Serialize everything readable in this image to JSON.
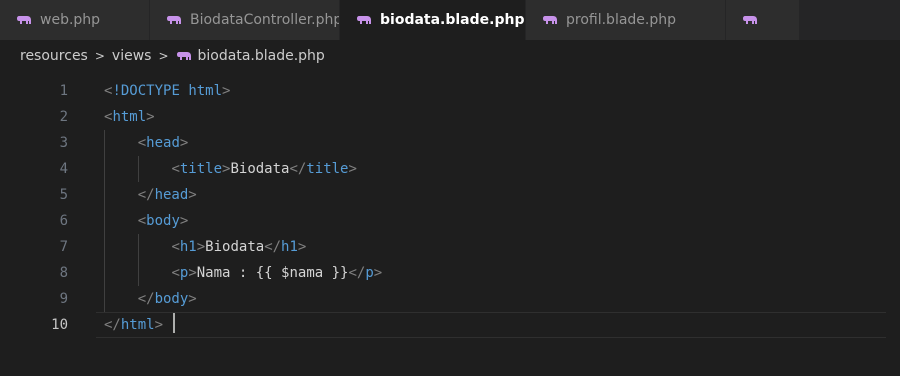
{
  "tabs": [
    {
      "label": "web.php",
      "active": false,
      "icon": "php-elephant-icon"
    },
    {
      "label": "BiodataController.php",
      "active": false,
      "icon": "php-elephant-icon"
    },
    {
      "label": "biodata.blade.php",
      "active": true,
      "icon": "php-elephant-icon",
      "close": "×"
    },
    {
      "label": "profil.blade.php",
      "active": false,
      "icon": "php-elephant-icon"
    }
  ],
  "breadcrumb": {
    "parts": [
      "resources",
      "views",
      "biodata.blade.php"
    ],
    "separator": ">"
  },
  "editor": {
    "current_line": 10,
    "lines": [
      {
        "number": "1",
        "tokens": [
          [
            "punct",
            "<"
          ],
          [
            "tag",
            "!DOCTYPE"
          ],
          [
            "txt",
            " "
          ],
          [
            "tag",
            "html"
          ],
          [
            "punct",
            ">"
          ]
        ]
      },
      {
        "number": "2",
        "tokens": [
          [
            "punct",
            "<"
          ],
          [
            "tag",
            "html"
          ],
          [
            "punct",
            ">"
          ]
        ]
      },
      {
        "number": "3",
        "tokens": [
          [
            "txt",
            "    "
          ],
          [
            "punct",
            "<"
          ],
          [
            "tag",
            "head"
          ],
          [
            "punct",
            ">"
          ]
        ]
      },
      {
        "number": "4",
        "tokens": [
          [
            "txt",
            "        "
          ],
          [
            "punct",
            "<"
          ],
          [
            "tag",
            "title"
          ],
          [
            "punct",
            ">"
          ],
          [
            "txt",
            "Biodata"
          ],
          [
            "punct",
            "</"
          ],
          [
            "tag",
            "title"
          ],
          [
            "punct",
            ">"
          ]
        ]
      },
      {
        "number": "5",
        "tokens": [
          [
            "txt",
            "    "
          ],
          [
            "punct",
            "</"
          ],
          [
            "tag",
            "head"
          ],
          [
            "punct",
            ">"
          ]
        ]
      },
      {
        "number": "6",
        "tokens": [
          [
            "txt",
            "    "
          ],
          [
            "punct",
            "<"
          ],
          [
            "tag",
            "body"
          ],
          [
            "punct",
            ">"
          ]
        ]
      },
      {
        "number": "7",
        "tokens": [
          [
            "txt",
            "        "
          ],
          [
            "punct",
            "<"
          ],
          [
            "tag",
            "h1"
          ],
          [
            "punct",
            ">"
          ],
          [
            "txt",
            "Biodata"
          ],
          [
            "punct",
            "</"
          ],
          [
            "tag",
            "h1"
          ],
          [
            "punct",
            ">"
          ]
        ]
      },
      {
        "number": "8",
        "tokens": [
          [
            "txt",
            "        "
          ],
          [
            "punct",
            "<"
          ],
          [
            "tag",
            "p"
          ],
          [
            "punct",
            ">"
          ],
          [
            "txt",
            "Nama : {{ $nama }}"
          ],
          [
            "punct",
            "</"
          ],
          [
            "tag",
            "p"
          ],
          [
            "punct",
            ">"
          ]
        ]
      },
      {
        "number": "9",
        "tokens": [
          [
            "txt",
            "    "
          ],
          [
            "punct",
            "</"
          ],
          [
            "tag",
            "body"
          ],
          [
            "punct",
            ">"
          ]
        ]
      },
      {
        "number": "10",
        "tokens": [
          [
            "punct",
            "</"
          ],
          [
            "tag",
            "html"
          ],
          [
            "punct",
            ">"
          ],
          [
            "txt",
            " "
          ]
        ]
      }
    ]
  },
  "colors": {
    "background": "#1e1e1e",
    "tabbar": "#252526",
    "tab_inactive": "#2d2d2d",
    "tag": "#569cd6",
    "punct": "#808080",
    "text": "#d4d4d4",
    "php_icon": "#c792ea"
  }
}
